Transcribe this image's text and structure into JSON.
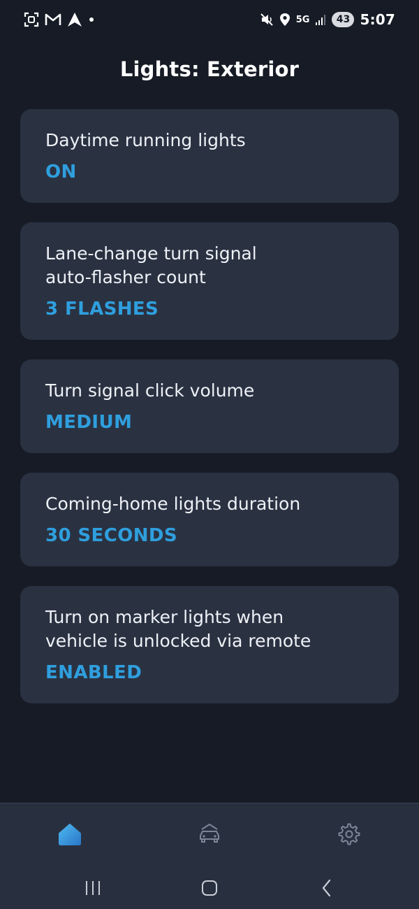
{
  "status_bar": {
    "time": "5:07",
    "network": "5G",
    "battery": "43"
  },
  "header": {
    "title": "Lights: Exterior"
  },
  "settings": [
    {
      "label": "Daytime running lights",
      "value": "ON"
    },
    {
      "label": "Lane-change turn signal\nauto-flasher count",
      "value": "3 FLASHES"
    },
    {
      "label": "Turn signal click volume",
      "value": "MEDIUM"
    },
    {
      "label": "Coming-home lights duration",
      "value": "30 SECONDS"
    },
    {
      "label": "Turn on marker lights when\nvehicle is unlocked via remote",
      "value": "ENABLED"
    }
  ],
  "bottom_nav": {
    "items": [
      {
        "icon": "home-icon",
        "active": true
      },
      {
        "icon": "car-icon",
        "active": false
      },
      {
        "icon": "gear-icon",
        "active": false
      }
    ]
  },
  "colors": {
    "background": "#161b25",
    "card": "#2a3242",
    "accent": "#2f9fde",
    "text": "#ffffff"
  }
}
